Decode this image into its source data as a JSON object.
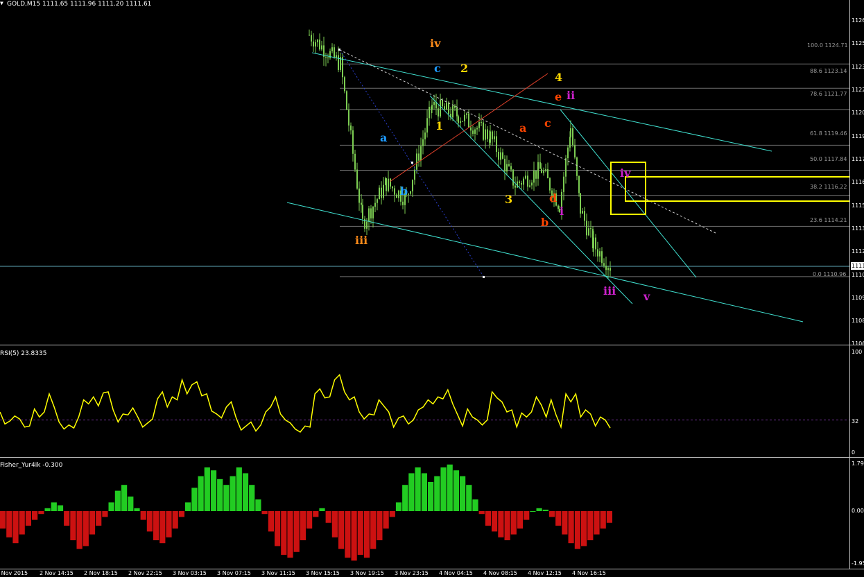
{
  "chart": {
    "symbol_title": "GOLD,M15  1111.65 1111.96 1111.20 1111.61",
    "current_price_tag": "1111",
    "colors": {
      "background": "#000000",
      "candle": "#7CCD52",
      "channel": "#40E0D0",
      "rsi_line": "#FFFF00",
      "hist_pos": "#22CC22",
      "hist_neg": "#CC1111",
      "fib_line": "#6F6F6F",
      "box": "#FFFF00"
    }
  },
  "price_axis_labels": [
    "1126",
    "1125",
    "1123",
    "1122",
    "1120",
    "1119",
    "1117",
    "1116",
    "1115",
    "1113",
    "1112",
    "1110",
    "1109",
    "1108",
    "1106"
  ],
  "fibonacci_levels": [
    {
      "label": "100.0  1124.71"
    },
    {
      "label": "88.6  1123.14"
    },
    {
      "label": "78.6  1121.77"
    },
    {
      "label": "61.8  1119.46"
    },
    {
      "label": "50.0  1117.84"
    },
    {
      "label": "38.2  1116.22"
    },
    {
      "label": "23.6  1114.21"
    },
    {
      "label": "0.0  1110.96"
    }
  ],
  "wave_labels": [
    {
      "text": "iv",
      "color": "#FF8C1A"
    },
    {
      "text": "iii",
      "color": "#FF8C1A"
    },
    {
      "text": "c",
      "color": "#1E9BFF"
    },
    {
      "text": "a",
      "color": "#1E9BFF"
    },
    {
      "text": "b",
      "color": "#1E9BFF"
    },
    {
      "text": "2",
      "color": "#FFD700"
    },
    {
      "text": "1",
      "color": "#FFD700"
    },
    {
      "text": "3",
      "color": "#FFD700"
    },
    {
      "text": "4",
      "color": "#FFD700"
    },
    {
      "text": "e",
      "color": "#FF4500"
    },
    {
      "text": "a",
      "color": "#FF4500"
    },
    {
      "text": "c",
      "color": "#FF4500"
    },
    {
      "text": "d",
      "color": "#FF4500"
    },
    {
      "text": "b",
      "color": "#FF4500"
    },
    {
      "text": "ii",
      "color": "#CC22CC"
    },
    {
      "text": "iv",
      "color": "#CC22CC"
    },
    {
      "text": "i",
      "color": "#CC22CC"
    },
    {
      "text": "iii",
      "color": "#CC22CC"
    },
    {
      "text": "v",
      "color": "#CC22CC"
    }
  ],
  "rsi": {
    "title": "RSI(5) 23.8335",
    "axis_labels": [
      "100",
      "32",
      "0"
    ],
    "level": 32
  },
  "fisher": {
    "title": "Fisher_Yur4ik -0.300",
    "axis_labels": [
      "1.79",
      "0.00",
      "-1.95"
    ]
  },
  "time_axis_labels": [
    "2 Nov 2015",
    "2 Nov 14:15",
    "2 Nov 18:15",
    "2 Nov 22:15",
    "3 Nov 03:15",
    "3 Nov 07:15",
    "3 Nov 11:15",
    "3 Nov 15:15",
    "3 Nov 19:15",
    "3 Nov 23:15",
    "4 Nov 04:15",
    "4 Nov 08:15",
    "4 Nov 12:15",
    "4 Nov 16:15"
  ],
  "chart_data": {
    "type": "line",
    "title": "GOLD,M15",
    "price_points": [
      {
        "x": "3 Nov 13:45",
        "y": 1126.6
      },
      {
        "x": "3 Nov 15:15",
        "y": 1124.7
      },
      {
        "x": "3 Nov 17:15",
        "y": 1114.4
      },
      {
        "x": "3 Nov 19:15",
        "y": 1117.0
      },
      {
        "x": "3 Nov 21:15",
        "y": 1116.0
      },
      {
        "x": "3 Nov 23:15",
        "y": 1122.0
      },
      {
        "x": "4 Nov 01:15",
        "y": 1121.4
      },
      {
        "x": "4 Nov 04:15",
        "y": 1120.0
      },
      {
        "x": "4 Nov 06:15",
        "y": 1116.9
      },
      {
        "x": "4 Nov 08:15",
        "y": 1117.9
      },
      {
        "x": "4 Nov 10:15",
        "y": 1115.6
      },
      {
        "x": "4 Nov 12:15",
        "y": 1120.6
      },
      {
        "x": "4 Nov 13:15",
        "y": 1115.3
      },
      {
        "x": "4 Nov 15:15",
        "y": 1113.0
      },
      {
        "x": "4 Nov 17:15",
        "y": 1111.6
      }
    ],
    "rsi_series": {
      "name": "RSI(5)",
      "values": [
        40,
        28,
        31,
        36,
        33,
        25,
        26,
        43,
        35,
        40,
        58,
        45,
        30,
        23,
        27,
        24,
        35,
        52,
        48,
        55,
        46,
        59,
        60,
        42,
        30,
        38,
        37,
        44,
        35,
        25,
        29,
        33,
        53,
        60,
        45,
        55,
        52,
        72,
        58,
        67,
        70,
        56,
        58,
        41,
        38,
        34,
        45,
        50,
        34,
        22,
        26,
        30,
        21,
        27,
        40,
        45,
        55,
        38,
        32,
        29,
        23,
        20,
        26,
        25,
        58,
        63,
        54,
        55,
        72,
        77,
        60,
        52,
        55,
        40,
        33,
        38,
        37,
        52,
        46,
        40,
        25,
        34,
        36,
        28,
        32,
        42,
        45,
        52,
        48,
        55,
        53,
        62,
        48,
        37,
        26,
        43,
        35,
        32,
        27,
        32,
        60,
        54,
        50,
        40,
        42,
        25,
        39,
        35,
        40,
        55,
        47,
        35,
        52,
        37,
        25,
        58,
        50,
        58,
        35,
        42,
        38,
        26,
        35,
        32,
        24
      ]
    },
    "fisher_series": {
      "name": "Fisher_Yur4ik",
      "values": [
        -0.6,
        -0.9,
        -1.1,
        -0.8,
        -0.5,
        -0.3,
        -0.1,
        0.1,
        0.3,
        0.2,
        -0.5,
        -1.0,
        -1.3,
        -1.2,
        -0.8,
        -0.5,
        -0.2,
        0.3,
        0.7,
        0.9,
        0.5,
        0.1,
        -0.3,
        -0.7,
        -1.0,
        -1.1,
        -0.9,
        -0.6,
        -0.2,
        0.3,
        0.8,
        1.2,
        1.5,
        1.4,
        1.1,
        0.9,
        1.2,
        1.5,
        1.3,
        0.9,
        0.4,
        -0.1,
        -0.7,
        -1.2,
        -1.5,
        -1.6,
        -1.4,
        -1.0,
        -0.6,
        -0.2,
        0.1,
        -0.4,
        -0.9,
        -1.3,
        -1.6,
        -1.7,
        -1.5,
        -1.6,
        -1.3,
        -1.0,
        -0.6,
        -0.2,
        0.3,
        0.9,
        1.3,
        1.5,
        1.3,
        1.0,
        1.2,
        1.5,
        1.6,
        1.4,
        1.2,
        0.9,
        0.4,
        -0.1,
        -0.5,
        -0.7,
        -0.9,
        -1.0,
        -0.8,
        -0.6,
        -0.3,
        0.0,
        0.1,
        0.05,
        -0.2,
        -0.5,
        -0.8,
        -1.1,
        -1.3,
        -1.2,
        -1.0,
        -0.8,
        -0.6,
        -0.4
      ]
    },
    "xlabel": "",
    "ylabel": ""
  }
}
